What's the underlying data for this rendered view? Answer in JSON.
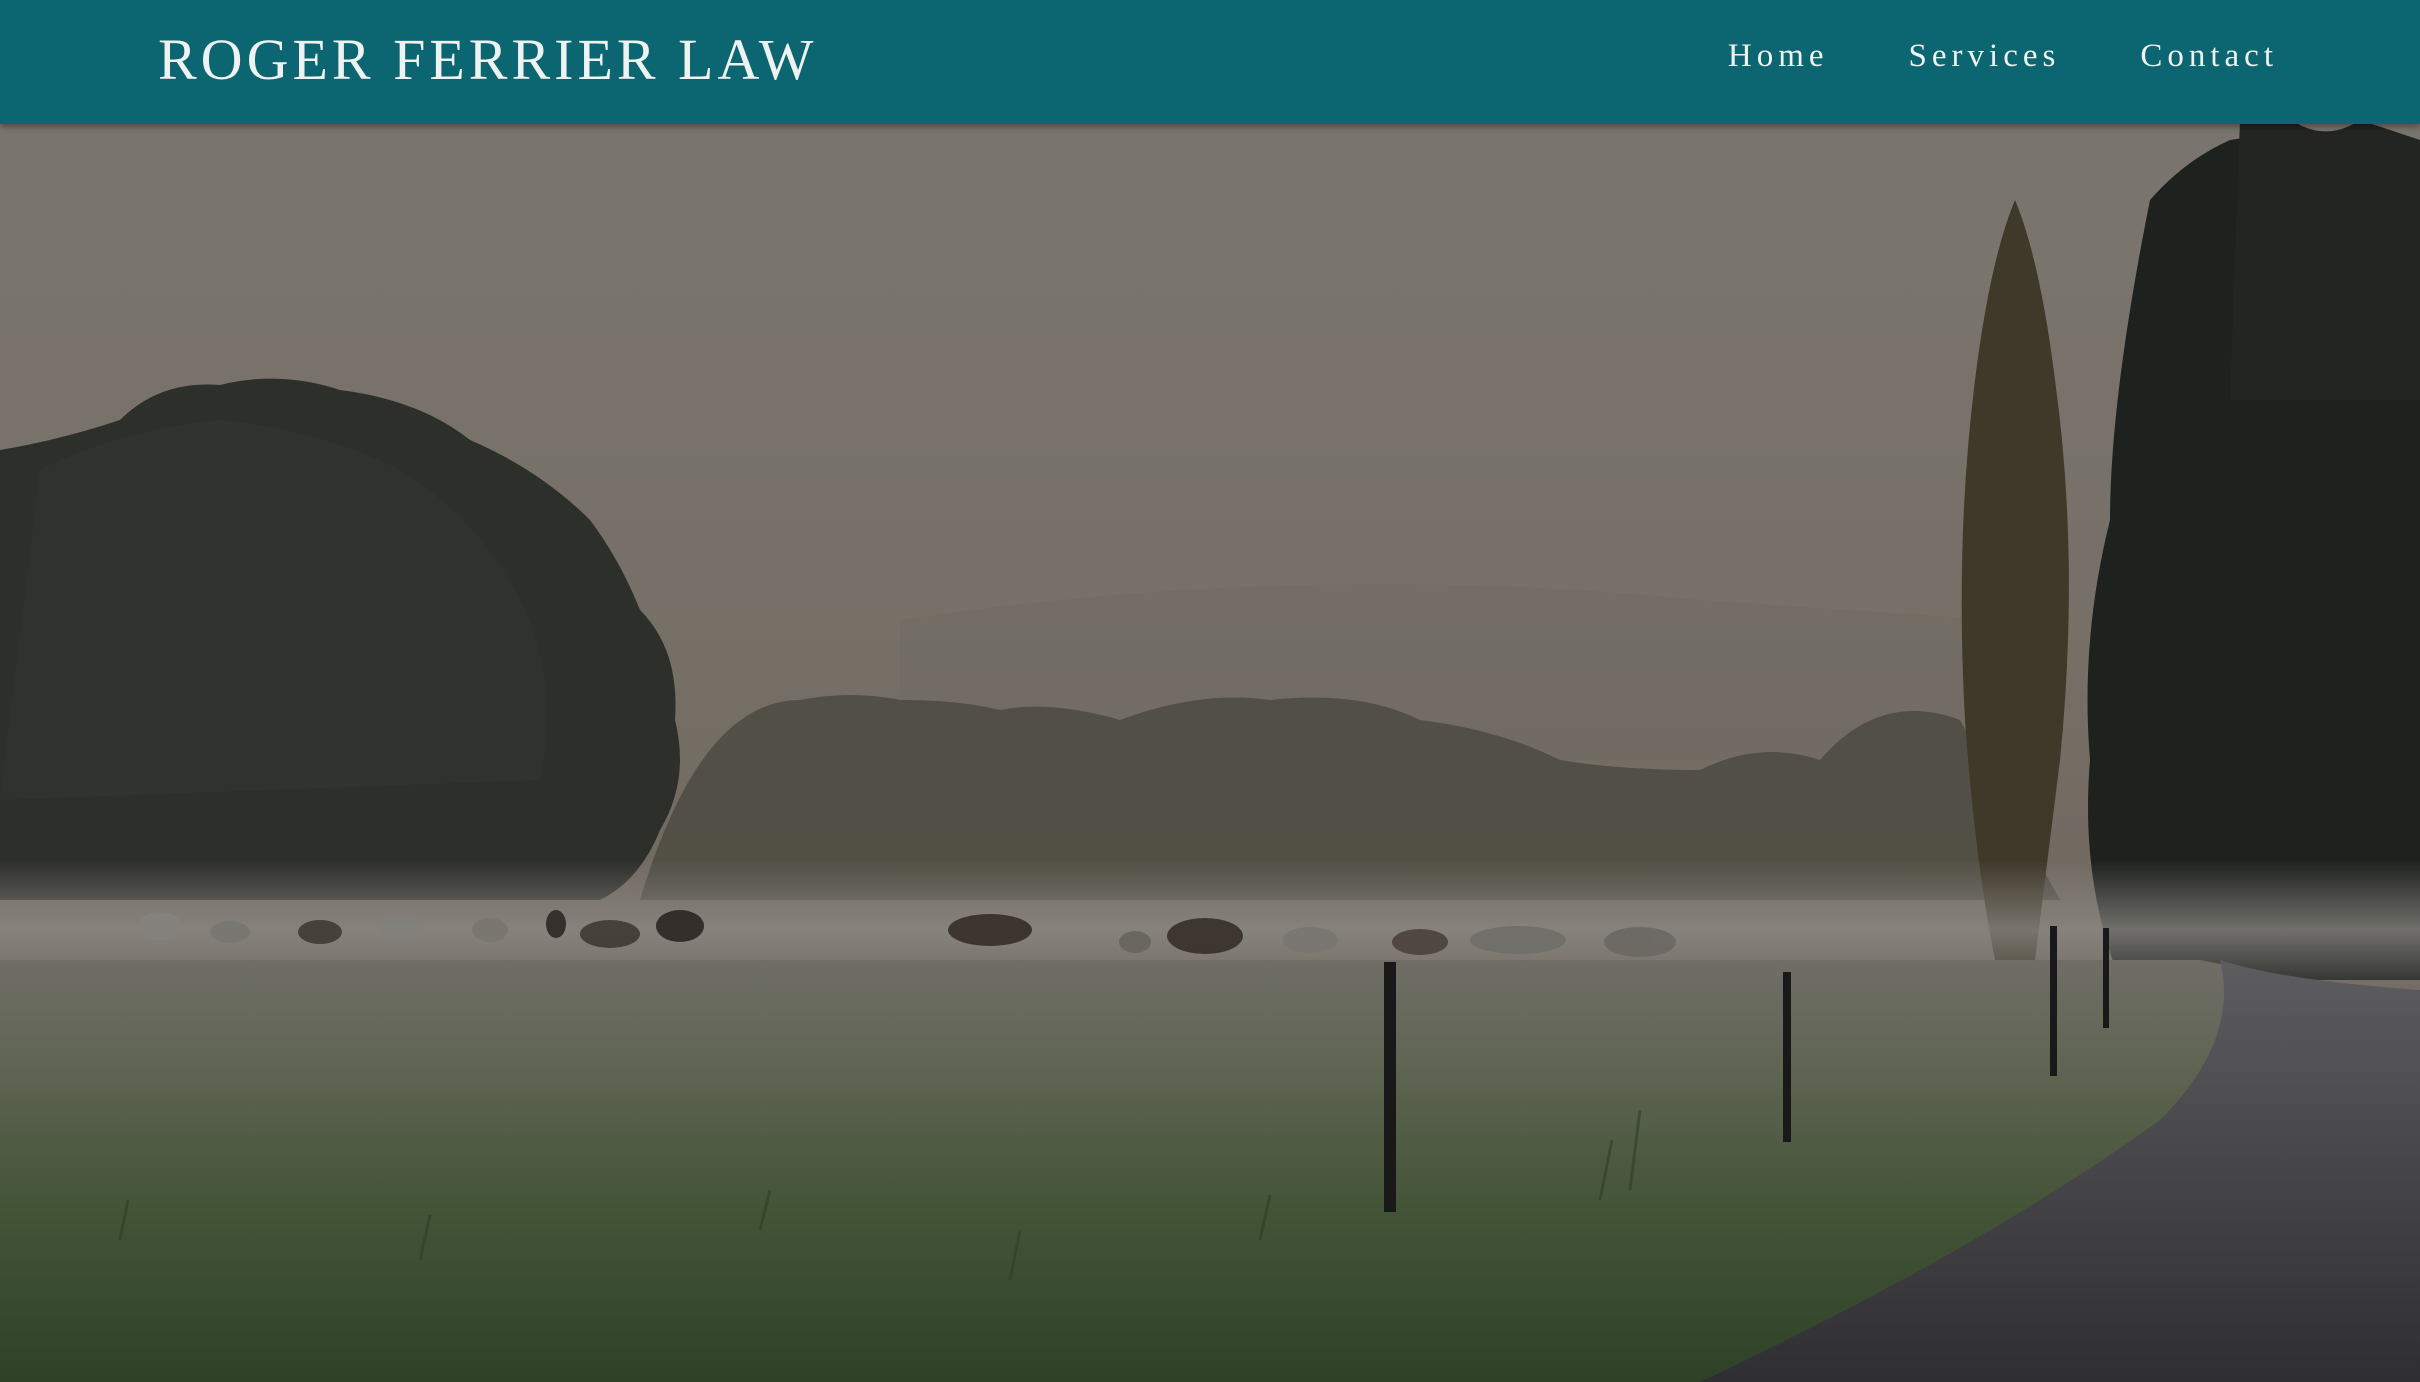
{
  "header": {
    "brand": "ROGER FERRIER LAW",
    "nav": [
      {
        "label": "Home"
      },
      {
        "label": "Services"
      },
      {
        "label": "Contact"
      }
    ]
  },
  "colors": {
    "header_bg": "#0b6672",
    "header_text": "#eef2f0"
  },
  "hero": {
    "scene": "misty-pasture-landscape-image"
  }
}
